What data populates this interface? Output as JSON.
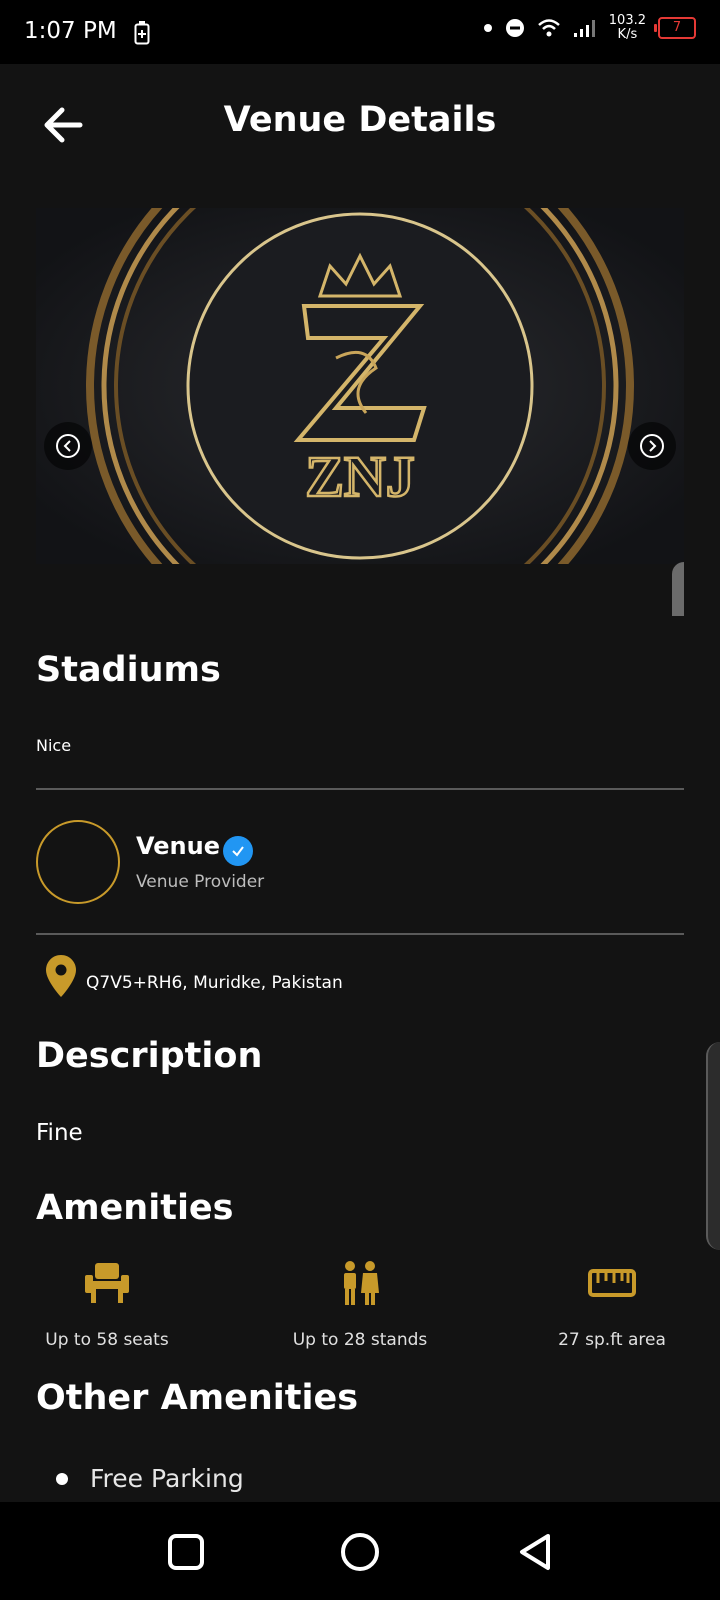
{
  "status_bar": {
    "time": "1:07 PM",
    "net_speed_value": "103.2",
    "net_speed_unit": "K/s",
    "battery_level": "7"
  },
  "header": {
    "title": "Venue Details",
    "back_icon": "arrow-left-icon"
  },
  "carousel": {
    "logo_text": "ZNJ",
    "prev_icon": "chevron-left-circle-icon",
    "next_icon": "chevron-right-circle-icon"
  },
  "venue": {
    "name": "Stadiums",
    "subtitle": "Nice"
  },
  "provider": {
    "name": "Venue",
    "role": "Venue Provider",
    "verified_icon": "check-badge-icon"
  },
  "location": {
    "address": "Q7V5+RH6, Muridke, Pakistan",
    "icon": "map-pin-icon"
  },
  "description": {
    "heading": "Description",
    "text": "Fine"
  },
  "amenities": {
    "heading": "Amenities",
    "items": [
      {
        "icon": "seat-icon",
        "label": "Up to 58 seats"
      },
      {
        "icon": "people-icon",
        "label": "Up to 28 stands"
      },
      {
        "icon": "ruler-icon",
        "label": "27 sp.ft area"
      }
    ]
  },
  "other_amenities": {
    "heading": "Other Amenities",
    "items": [
      "Free Parking"
    ]
  },
  "colors": {
    "accent": "#c89a2a",
    "background": "#131313",
    "verified": "#2196f3",
    "battery_low": "#e53935"
  },
  "nav_bar": {
    "recent_icon": "square-icon",
    "home_icon": "circle-icon",
    "back_icon": "triangle-back-icon"
  }
}
